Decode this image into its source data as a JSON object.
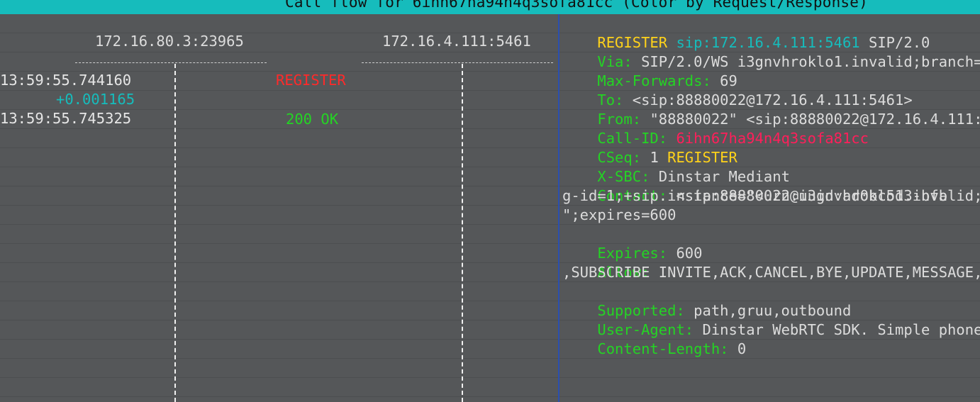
{
  "title": "Call flow for 6ihn67ha94n4q3sofa81cc (Color by Request/Response)",
  "hosts": {
    "left": "172.16.80.3:23965",
    "right": "172.16.4.111:5461"
  },
  "timeline": {
    "t1": "13:59:55.744160",
    "delta": "+0.001165",
    "t2": "13:59:55.745325"
  },
  "messages": [
    {
      "label": "REGISTER",
      "color": "#ff2a2a",
      "direction": "right"
    },
    {
      "label": "200 OK",
      "color": "#24d424",
      "direction": "left"
    }
  ],
  "detail": {
    "request_line": {
      "method": "REGISTER",
      "uri": "sip:172.16.4.111:5461",
      "version": "SIP/2.0"
    },
    "via": {
      "key": "Via:",
      "value": "SIP/2.0/WS i3gnvhroklo1.invalid;branch="
    },
    "max_forwards": {
      "key": "Max-Forwards:",
      "value": "69"
    },
    "to": {
      "key": "To:",
      "value": "<sip:88880022@172.16.4.111:5461>"
    },
    "from": {
      "key": "From:",
      "value": "\"88880022\" <sip:88880022@172.16.4.111:"
    },
    "call_id": {
      "key": "Call-ID:",
      "value": "6ihn67ha94n4q3sofa81cc"
    },
    "cseq": {
      "key": "CSeq:",
      "num": "1",
      "method": "REGISTER"
    },
    "x_sbc": {
      "key": "X-SBC:",
      "value": "Dinstar Mediant"
    },
    "contact": {
      "key": "Contact:",
      "value": "<sip:88880022@i3gnvhroklo1.invalid;",
      "cont1": "g-id=1;+sip.instance=\"<urn:uuid:ad0bc5d3-bfb",
      "cont2": "\";expires=600"
    },
    "expires": {
      "key": "Expires:",
      "value": "600"
    },
    "allow": {
      "key": "Allow:",
      "value": "INVITE,ACK,CANCEL,BYE,UPDATE,MESSAGE,",
      "cont1": ",SUBSCRIBE"
    },
    "supported": {
      "key": "Supported:",
      "value": "path,gruu,outbound"
    },
    "user_agent": {
      "key": "User-Agent:",
      "value": "Dinstar WebRTC SDK. Simple phone"
    },
    "content_length": {
      "key": "Content-Length:",
      "value": "0"
    }
  }
}
